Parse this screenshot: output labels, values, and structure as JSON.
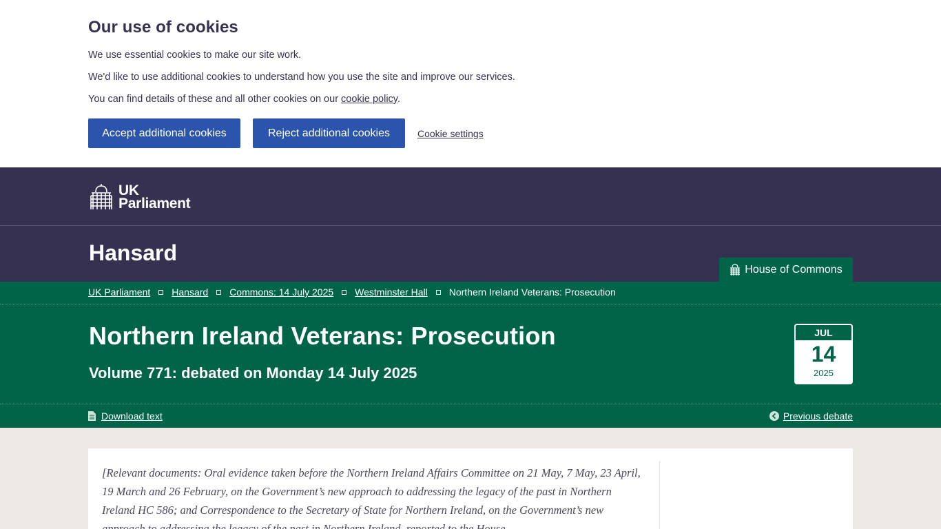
{
  "cookie_banner": {
    "title": "Our use of cookies",
    "line1": "We use essential cookies to make our site work.",
    "line2": "We'd like to use additional cookies to understand how you use the site and improve our services.",
    "line3_prefix": "You can find details of these and all other cookies on our ",
    "line3_link": "cookie policy",
    "line3_suffix": ".",
    "accept_label": "Accept additional cookies",
    "reject_label": "Reject additional cookies",
    "settings_label": "Cookie settings"
  },
  "header": {
    "brand_line1": "UK",
    "brand_line2": "Parliament",
    "site_title": "Hansard",
    "house_tab": "House of Commons"
  },
  "breadcrumb": [
    "UK Parliament",
    "Hansard",
    "Commons: 14 July 2025",
    "Westminster Hall",
    "Northern Ireland Veterans: Prosecution"
  ],
  "debate": {
    "title": "Northern Ireland Veterans: Prosecution",
    "subtitle": "Volume 771: debated on Monday 14 July 2025",
    "cal_month": "JUL",
    "cal_day": "14",
    "cal_year": "2025",
    "download_label": "Download text",
    "previous_label": "Previous debate"
  },
  "content": {
    "intro": "[Relevant documents: Oral evidence taken before the Northern Ireland Affairs Committee on 21 May, 7 May, 23 April, 19 March and 26 February, on the Government’s new approach to addressing the legacy of the past in Northern Ireland HC 586; and Correspondence to the Secretary of State for Northern Ireland, on the Government’s new approach to addressing the legacy of the past in Northern Ireland, reported to the House"
  },
  "colors": {
    "header_bg": "#373151",
    "commons_green": "#006548",
    "button_blue": "#2b55ad",
    "page_bg": "#edeae6"
  }
}
